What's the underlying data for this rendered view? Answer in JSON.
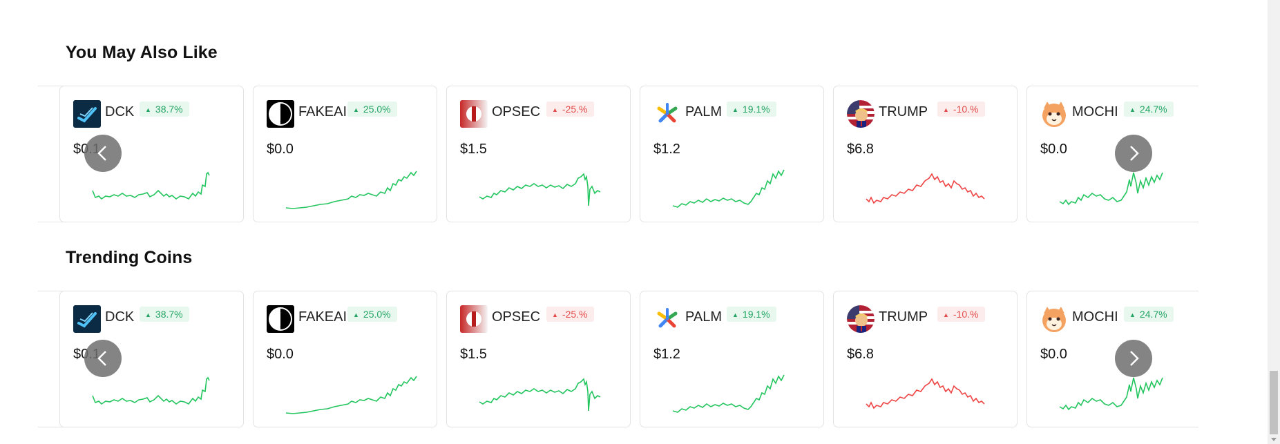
{
  "sections": [
    {
      "title": "You May Also Like",
      "cards": [
        {
          "symbol": "DCK",
          "change": "38.7%",
          "direction": "up",
          "price": "$0.1",
          "icon": "dck-logo-icon"
        },
        {
          "symbol": "FAKEAI",
          "change": "25.0%",
          "direction": "up",
          "price": "$0.0",
          "icon": "fakeai-logo-icon"
        },
        {
          "symbol": "OPSEC",
          "change": "-25.%",
          "direction": "down",
          "price": "$1.5",
          "icon": "opsec-logo-icon"
        },
        {
          "symbol": "PALM",
          "change": "19.1%",
          "direction": "up",
          "price": "$1.2",
          "icon": "palm-logo-icon"
        },
        {
          "symbol": "TRUMP",
          "change": "-10.%",
          "direction": "down",
          "price": "$6.8",
          "icon": "trump-logo-icon"
        },
        {
          "symbol": "MOCHI",
          "change": "24.7%",
          "direction": "up",
          "price": "$0.0",
          "icon": "mochi-logo-icon"
        }
      ],
      "prev_icon": "chevron-left-icon",
      "next_icon": "chevron-right-icon"
    },
    {
      "title": "Trending Coins",
      "cards": [
        {
          "symbol": "DCK",
          "change": "38.7%",
          "direction": "up",
          "price": "$0.1",
          "icon": "dck-logo-icon"
        },
        {
          "symbol": "FAKEAI",
          "change": "25.0%",
          "direction": "up",
          "price": "$0.0",
          "icon": "fakeai-logo-icon"
        },
        {
          "symbol": "OPSEC",
          "change": "-25.%",
          "direction": "down",
          "price": "$1.5",
          "icon": "opsec-logo-icon"
        },
        {
          "symbol": "PALM",
          "change": "19.1%",
          "direction": "up",
          "price": "$1.2",
          "icon": "palm-logo-icon"
        },
        {
          "symbol": "TRUMP",
          "change": "-10.%",
          "direction": "down",
          "price": "$6.8",
          "icon": "trump-logo-icon"
        },
        {
          "symbol": "MOCHI",
          "change": "24.7%",
          "direction": "up",
          "price": "$0.0",
          "icon": "mochi-logo-icon"
        }
      ],
      "prev_icon": "chevron-left-icon",
      "next_icon": "chevron-right-icon"
    }
  ],
  "colors": {
    "up": "#22c55e",
    "down": "#ef4444",
    "badge_up_text": "#22a463",
    "badge_down_text": "#e34b4b"
  }
}
